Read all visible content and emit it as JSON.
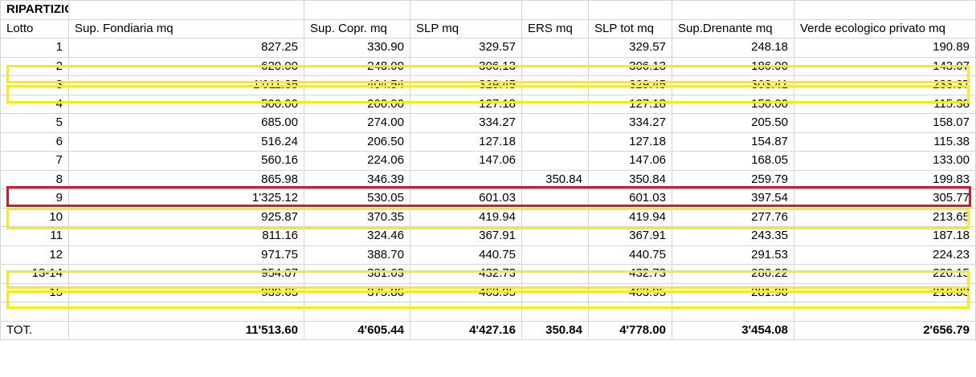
{
  "sheet": {
    "title": "RIPARTIZIONE POSSIBILITA' EDIFICATORIA",
    "headers": [
      "Lotto",
      "Sup. Fondiaria mq",
      "Sup. Copr. mq",
      "SLP mq",
      "ERS mq",
      "SLP tot mq",
      "Sup.Drenante mq",
      "Verde ecologico privato mq"
    ],
    "rows": [
      [
        "1",
        "827.25",
        "330.90",
        "329.57",
        "",
        "329.57",
        "248.18",
        "190.89"
      ],
      [
        "2",
        "620.00",
        "248.00",
        "306.13",
        "",
        "306.13",
        "186.00",
        "143.07"
      ],
      [
        "3",
        "1'011.35",
        "404.54",
        "329.45",
        "",
        "329.45",
        "303.41",
        "233.37"
      ],
      [
        "4",
        "500.00",
        "200.00",
        "127.18",
        "",
        "127.18",
        "150.00",
        "115.38"
      ],
      [
        "5",
        "685.00",
        "274.00",
        "334.27",
        "",
        "334.27",
        "205.50",
        "158.07"
      ],
      [
        "6",
        "516.24",
        "206.50",
        "127.18",
        "",
        "127.18",
        "154.87",
        "115.38"
      ],
      [
        "7",
        "560.16",
        "224.06",
        "147.06",
        "",
        "147.06",
        "168.05",
        "133.00"
      ],
      [
        "8",
        "865.98",
        "346.39",
        "",
        "350.84",
        "350.84",
        "259.79",
        "199.83"
      ],
      [
        "9",
        "1'325.12",
        "530.05",
        "601.03",
        "",
        "601.03",
        "397.54",
        "305.77"
      ],
      [
        "10",
        "925.87",
        "370.35",
        "419.94",
        "",
        "419.94",
        "277.76",
        "213.65"
      ],
      [
        "11",
        "811.16",
        "324.46",
        "367.91",
        "",
        "367.91",
        "243.35",
        "187.18"
      ],
      [
        "12",
        "971.75",
        "388.70",
        "440.75",
        "",
        "440.75",
        "291.53",
        "224.23"
      ],
      [
        "13-14",
        "954.07",
        "381.63",
        "432.73",
        "",
        "432.73",
        "286.22",
        "220.15"
      ],
      [
        "15",
        "939.65",
        "375.86",
        "463.95",
        "",
        "463.95",
        "281.90",
        "216.83"
      ]
    ],
    "total": [
      "TOT.",
      "11'513.60",
      "4'605.44",
      "4'427.16",
      "350.84",
      "4'778.00",
      "3'454.08",
      "2'656.79"
    ],
    "highlight_colors": {
      "yellow": "#f5ec1c",
      "red": "#c8202c"
    }
  }
}
